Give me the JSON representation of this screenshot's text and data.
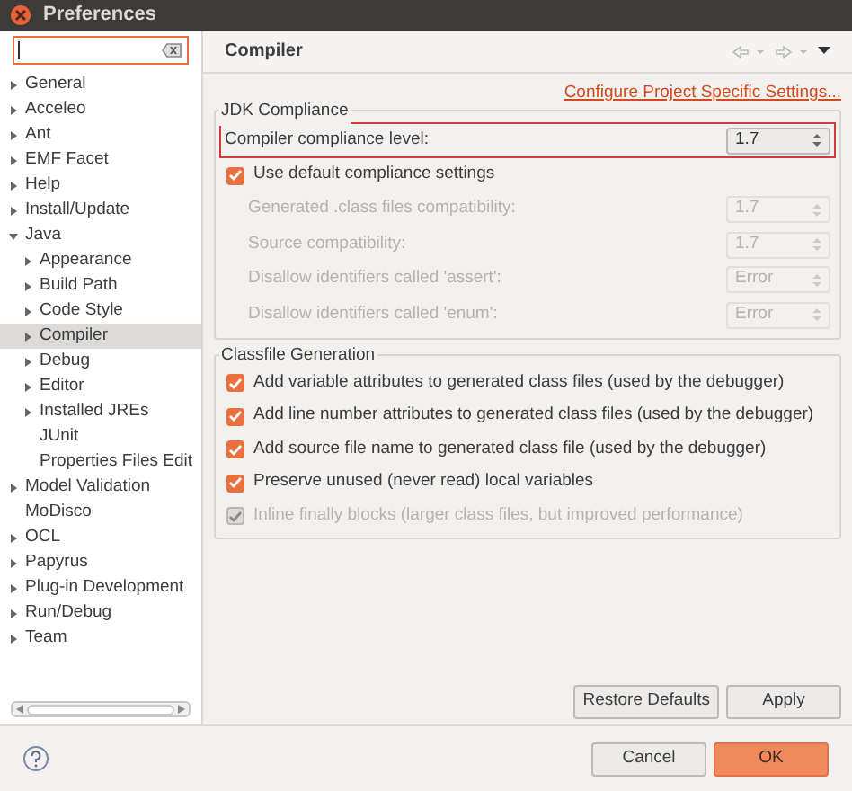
{
  "window": {
    "title": "Preferences"
  },
  "search": {
    "focused": true
  },
  "tree": [
    {
      "label": "General",
      "kind": "branch",
      "expanded": false,
      "selected": false
    },
    {
      "label": "Acceleo",
      "kind": "branch",
      "expanded": false,
      "selected": false
    },
    {
      "label": "Ant",
      "kind": "branch",
      "expanded": false,
      "selected": false
    },
    {
      "label": "EMF Facet",
      "kind": "branch",
      "expanded": false,
      "selected": false
    },
    {
      "label": "Help",
      "kind": "branch",
      "expanded": false,
      "selected": false
    },
    {
      "label": "Install/Update",
      "kind": "branch",
      "expanded": false,
      "selected": false
    },
    {
      "label": "Java",
      "kind": "branch",
      "expanded": true,
      "selected": false,
      "children": [
        {
          "label": "Appearance",
          "kind": "branch",
          "expanded": false,
          "selected": false
        },
        {
          "label": "Build Path",
          "kind": "branch",
          "expanded": false,
          "selected": false
        },
        {
          "label": "Code Style",
          "kind": "branch",
          "expanded": false,
          "selected": false
        },
        {
          "label": "Compiler",
          "kind": "branch",
          "expanded": false,
          "selected": true
        },
        {
          "label": "Debug",
          "kind": "branch",
          "expanded": false,
          "selected": false
        },
        {
          "label": "Editor",
          "kind": "branch",
          "expanded": false,
          "selected": false
        },
        {
          "label": "Installed JREs",
          "kind": "branch",
          "expanded": false,
          "selected": false
        },
        {
          "label": "JUnit",
          "kind": "leaf",
          "selected": false
        },
        {
          "label": "Properties Files Edit",
          "kind": "leaf",
          "selected": false
        }
      ]
    },
    {
      "label": "Model Validation",
      "kind": "branch",
      "expanded": false,
      "selected": false
    },
    {
      "label": "MoDisco",
      "kind": "leaf",
      "selected": false
    },
    {
      "label": "OCL",
      "kind": "branch",
      "expanded": false,
      "selected": false
    },
    {
      "label": "Papyrus",
      "kind": "branch",
      "expanded": false,
      "selected": false
    },
    {
      "label": "Plug-in Development",
      "kind": "branch",
      "expanded": false,
      "selected": false
    },
    {
      "label": "Run/Debug",
      "kind": "branch",
      "expanded": false,
      "selected": false
    },
    {
      "label": "Team",
      "kind": "branch",
      "expanded": false,
      "selected": false
    }
  ],
  "page": {
    "title": "Compiler",
    "link": "Configure Project Specific Settings...",
    "jdk_group": {
      "title": "JDK Compliance",
      "compliance": {
        "label": "Compiler compliance level:",
        "value": "1.7",
        "highlighted": true
      },
      "use_default": {
        "label": "Use default compliance settings",
        "checked": true,
        "disabled": false
      },
      "settings": [
        {
          "label": "Generated .class files compatibility:",
          "value": "1.7",
          "disabled": true
        },
        {
          "label": "Source compatibility:",
          "value": "1.7",
          "disabled": true
        },
        {
          "label": "Disallow identifiers called 'assert':",
          "value": "Error",
          "disabled": true
        },
        {
          "label": "Disallow identifiers called 'enum':",
          "value": "Error",
          "disabled": true
        }
      ]
    },
    "classfile_group": {
      "title": "Classfile Generation",
      "options": [
        {
          "label": "Add variable attributes to generated class files (used by the debugger)",
          "checked": true,
          "disabled": false
        },
        {
          "label": "Add line number attributes to generated class files (used by the debugger)",
          "checked": true,
          "disabled": false
        },
        {
          "label": "Add source file name to generated class file (used by the debugger)",
          "checked": true,
          "disabled": false
        },
        {
          "label": "Preserve unused (never read) local variables",
          "checked": true,
          "disabled": false
        },
        {
          "label": "Inline finally blocks (larger class files, but improved performance)",
          "checked": true,
          "disabled": true
        }
      ]
    },
    "buttons": [
      {
        "label": "Restore Defaults",
        "primary": false
      },
      {
        "label": "Apply",
        "primary": false
      }
    ]
  },
  "dialog_buttons": [
    {
      "label": "Cancel",
      "primary": false
    },
    {
      "label": "OK",
      "primary": true
    }
  ]
}
